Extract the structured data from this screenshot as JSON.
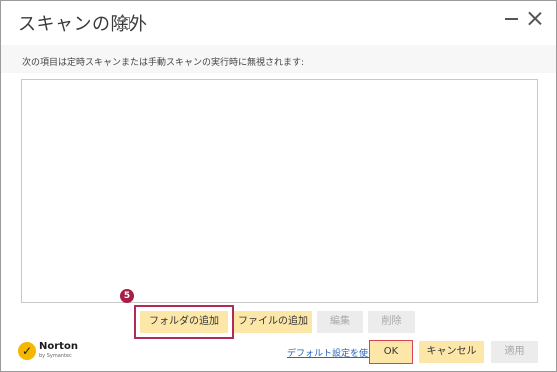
{
  "window": {
    "title": "スキャンの除外",
    "help_icon": "?"
  },
  "description": "次の項目は定時スキャンまたは手動スキャンの実行時に無視されます:",
  "list_buttons": {
    "add_folder": "フォルダの追加",
    "add_file": "ファイルの追加",
    "edit": "編集",
    "delete": "削除"
  },
  "annotation": {
    "step_number": "5",
    "highlight_color": "#b12b54"
  },
  "logo": {
    "name": "Norton",
    "sub": "by Symantec"
  },
  "footer": {
    "default_link": "デフォルト設定を使う",
    "ok": "OK",
    "cancel": "キャンセル",
    "apply": "適用"
  },
  "colors": {
    "button_yellow": "#fce7a9",
    "button_disabled": "#ececec",
    "link": "#2765b9"
  }
}
